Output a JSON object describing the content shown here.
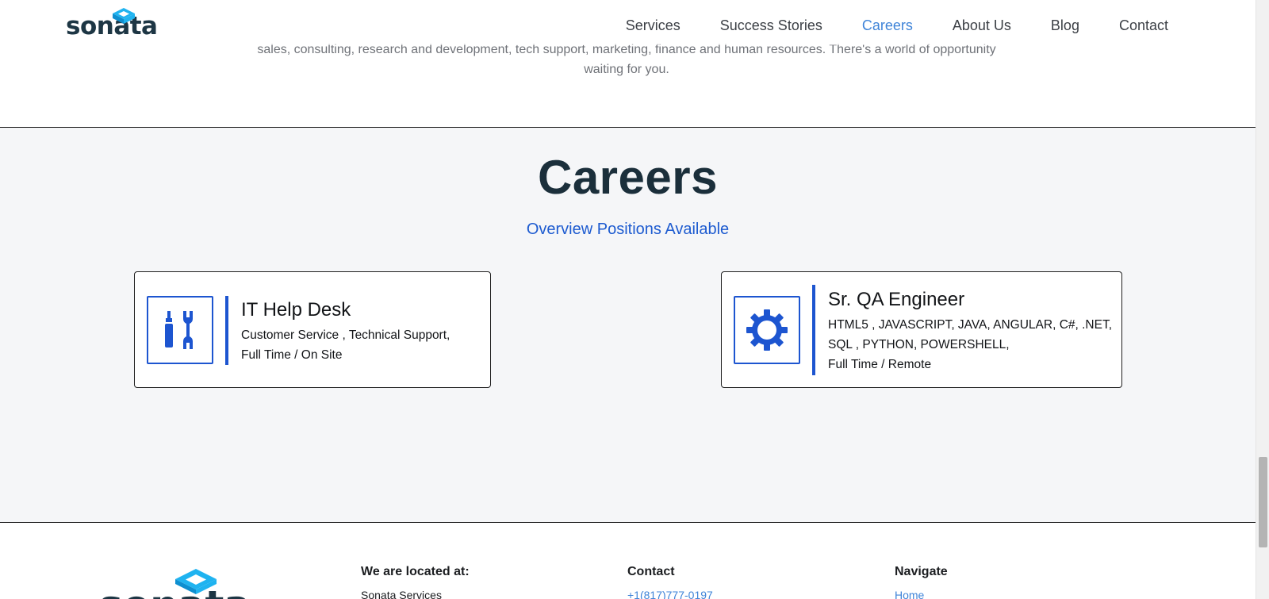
{
  "intro": {
    "line1": "sales, consulting, research and development, tech support, marketing, finance and human resources. There's a world of opportunity",
    "line2": "waiting for you."
  },
  "header": {
    "logo_text": "sonata",
    "nav": [
      {
        "label": "Services",
        "active": false
      },
      {
        "label": "Success Stories",
        "active": false
      },
      {
        "label": "Careers",
        "active": true
      },
      {
        "label": "About Us",
        "active": false
      },
      {
        "label": "Blog",
        "active": false
      },
      {
        "label": "Contact",
        "active": false
      }
    ]
  },
  "careers": {
    "title": "Careers",
    "subtitle": "Overview Positions Available",
    "jobs": [
      {
        "icon": "tools-icon",
        "title": "IT Help Desk",
        "lines": [
          "Customer Service , Technical Support,",
          "Full Time / On Site"
        ]
      },
      {
        "icon": "gear-icon",
        "title": "Sr. QA Engineer",
        "lines": [
          "HTML5 , JAVASCRIPT, JAVA, ANGULAR, C#, .NET,",
          "SQL , PYTHON, POWERSHELL,",
          "Full Time / Remote"
        ]
      }
    ]
  },
  "footer": {
    "logo_text": "sonata",
    "columns": [
      {
        "title": "We are located at:",
        "text": "Sonata Services"
      },
      {
        "title": "Contact",
        "text": "+1(817)777-0197"
      },
      {
        "title": "Navigate",
        "text": "Home"
      }
    ]
  },
  "colors": {
    "accent": "#1d55d0",
    "nav_active": "#3f84d8",
    "logo_cyan": "#1fb3f0",
    "heading": "#1b2f3b"
  }
}
